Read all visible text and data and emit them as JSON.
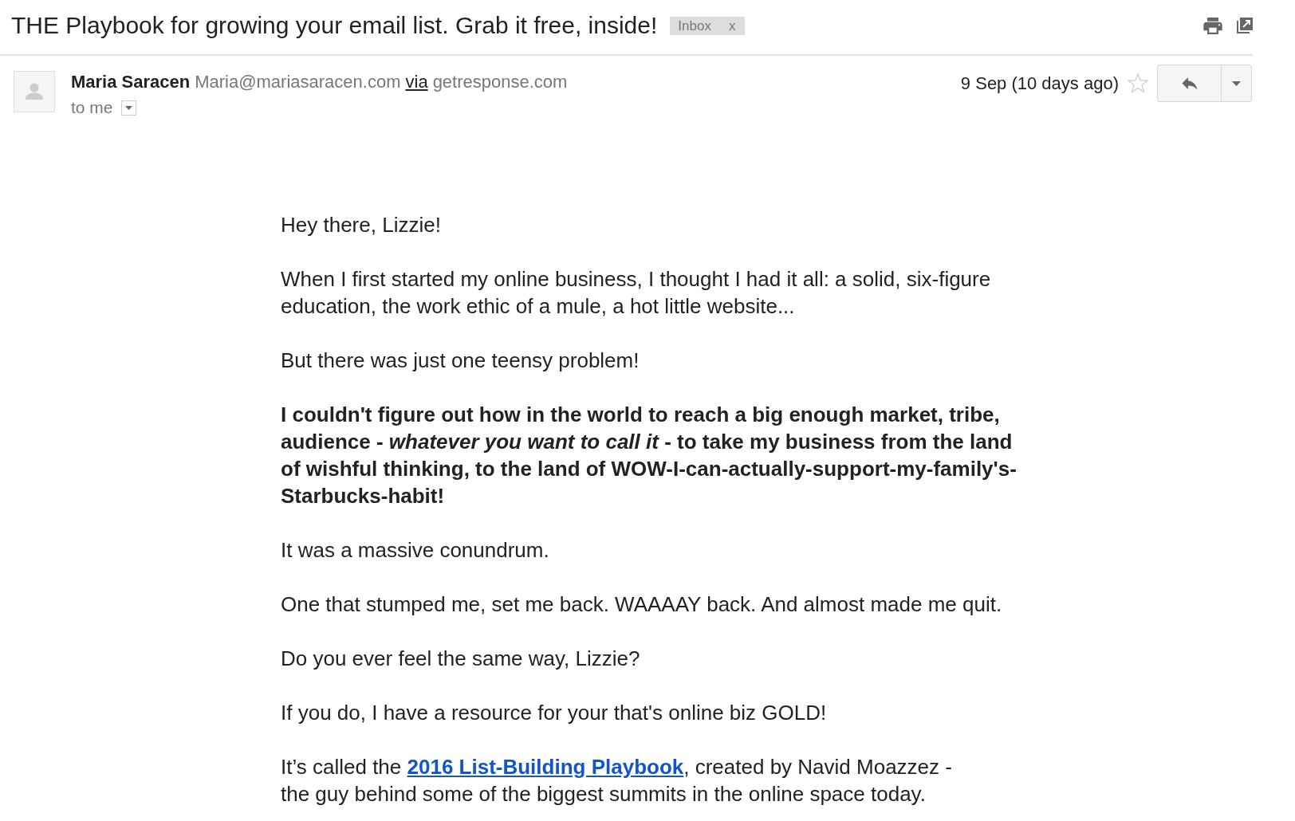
{
  "subject": {
    "title": "THE Playbook for growing your email list. Grab it free, inside!",
    "label": {
      "text": "Inbox",
      "remove": "x"
    }
  },
  "message": {
    "sender_name": "Maria Saracen",
    "sender_email": "Maria@mariasaracen.com",
    "via": "via",
    "via_domain": "getresponse.com",
    "recipient": "to me",
    "date": "9 Sep (10 days ago)",
    "starred": false
  },
  "body": [
    {
      "kind": "plain",
      "text": "Hey there, Lizzie!"
    },
    {
      "kind": "plain",
      "text": "When I first started my online business, I thought I had it all: a solid, six-figure education, the work ethic of a mule, a hot little website..."
    },
    {
      "kind": "plain",
      "text": "But there was just one teensy problem!"
    },
    {
      "kind": "bold",
      "text": "I couldn't figure out how in the world to reach a big enough market, tribe, audience - *whatever you want to call it* - to take my business from the land of wishful thinking, to the land of WOW-I-can-actually-support-my-family's-Starbucks-habit!"
    },
    {
      "kind": "plain",
      "text": "It was a massive conundrum."
    },
    {
      "kind": "plain",
      "text": "One that stumped me, set me back. WAAAAY back. And almost made me quit."
    },
    {
      "kind": "plain",
      "text": "Do you ever feel the same way, Lizzie?"
    },
    {
      "kind": "plain",
      "text": "If you do, I have a resource for your that's online biz GOLD!"
    },
    {
      "kind": "link",
      "text_before": "It’s called the ",
      "link": "2016 List-Building Playbook",
      "text_after": ", created by Navid Moazzez -",
      "continuation": "the guy behind some of the biggest summits in the online space today."
    }
  ]
}
